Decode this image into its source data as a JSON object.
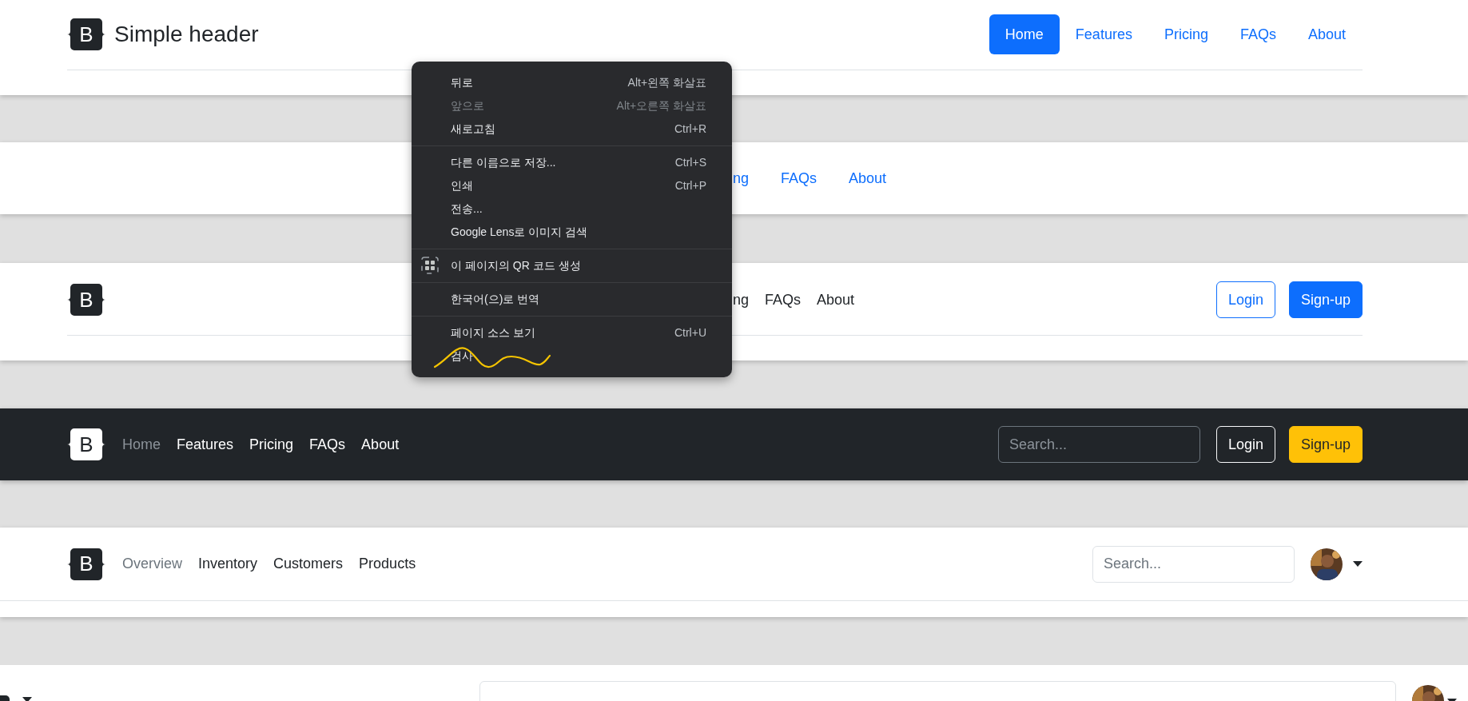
{
  "headers": [
    {
      "kind": "simple",
      "logo": "B",
      "brand": "Simple header",
      "nav": [
        {
          "label": "Home",
          "selected": true
        },
        {
          "label": "Features",
          "selected": false
        },
        {
          "label": "Pricing",
          "selected": false
        },
        {
          "label": "FAQs",
          "selected": false
        },
        {
          "label": "About",
          "selected": false
        }
      ]
    },
    {
      "kind": "centered",
      "nav": [
        {
          "label": "ng",
          "selected": false
        },
        {
          "label": "FAQs",
          "selected": false
        },
        {
          "label": "About",
          "selected": false
        }
      ]
    },
    {
      "kind": "buttons",
      "logo": "B",
      "nav": [
        {
          "label": "ng",
          "selected": false
        },
        {
          "label": "FAQs",
          "selected": false
        },
        {
          "label": "About",
          "selected": false
        }
      ],
      "buttons": [
        {
          "label": "Login"
        },
        {
          "label": "Sign-up"
        }
      ]
    },
    {
      "kind": "dark",
      "logo": "B",
      "nav": [
        {
          "label": "Home",
          "selected": true
        },
        {
          "label": "Features",
          "selected": false
        },
        {
          "label": "Pricing",
          "selected": false
        },
        {
          "label": "FAQs",
          "selected": false
        },
        {
          "label": "About",
          "selected": false
        }
      ],
      "search": {
        "placeholder": "Search..."
      },
      "buttons": [
        {
          "label": "Login"
        },
        {
          "label": "Sign-up"
        }
      ]
    },
    {
      "kind": "app",
      "logo": "B",
      "nav": [
        {
          "label": "Overview",
          "selected": true
        },
        {
          "label": "Inventory",
          "selected": false
        },
        {
          "label": "Customers",
          "selected": false
        },
        {
          "label": "Products",
          "selected": false
        }
      ],
      "search": {
        "placeholder": "Search..."
      },
      "avatar": {
        "kind": "picture"
      }
    },
    {
      "kind": "wide",
      "avatar": {
        "kind": "picture"
      }
    }
  ],
  "context_menu": {
    "groups": [
      {
        "items": [
          {
            "kind": "plain",
            "label": "뒤로",
            "shortcut": "Alt+왼쪽 화살표",
            "disabled": false
          },
          {
            "kind": "plain",
            "label": "앞으로",
            "shortcut": "Alt+오른쪽 화살표",
            "disabled": true
          },
          {
            "kind": "plain",
            "label": "새로고침",
            "shortcut": "Ctrl+R",
            "disabled": false
          }
        ]
      },
      {
        "items": [
          {
            "kind": "plain",
            "label": "다른 이름으로 저장...",
            "shortcut": "Ctrl+S",
            "disabled": false
          },
          {
            "kind": "plain",
            "label": "인쇄",
            "shortcut": "Ctrl+P",
            "disabled": false
          },
          {
            "kind": "plain",
            "label": "전송...",
            "disabled": false
          },
          {
            "kind": "plain",
            "label": "Google Lens로 이미지 검색",
            "disabled": false
          }
        ]
      },
      {
        "items": [
          {
            "kind": "qr",
            "label": "이 페이지의 QR 코드 생성",
            "disabled": false
          }
        ]
      },
      {
        "items": [
          {
            "kind": "plain",
            "label": "한국어(으)로 번역",
            "disabled": false
          }
        ]
      },
      {
        "items": [
          {
            "kind": "plain",
            "label": "페이지 소스 보기",
            "shortcut": "Ctrl+U",
            "disabled": false
          },
          {
            "kind": "plain",
            "label": "검사",
            "disabled": false
          }
        ]
      }
    ]
  }
}
